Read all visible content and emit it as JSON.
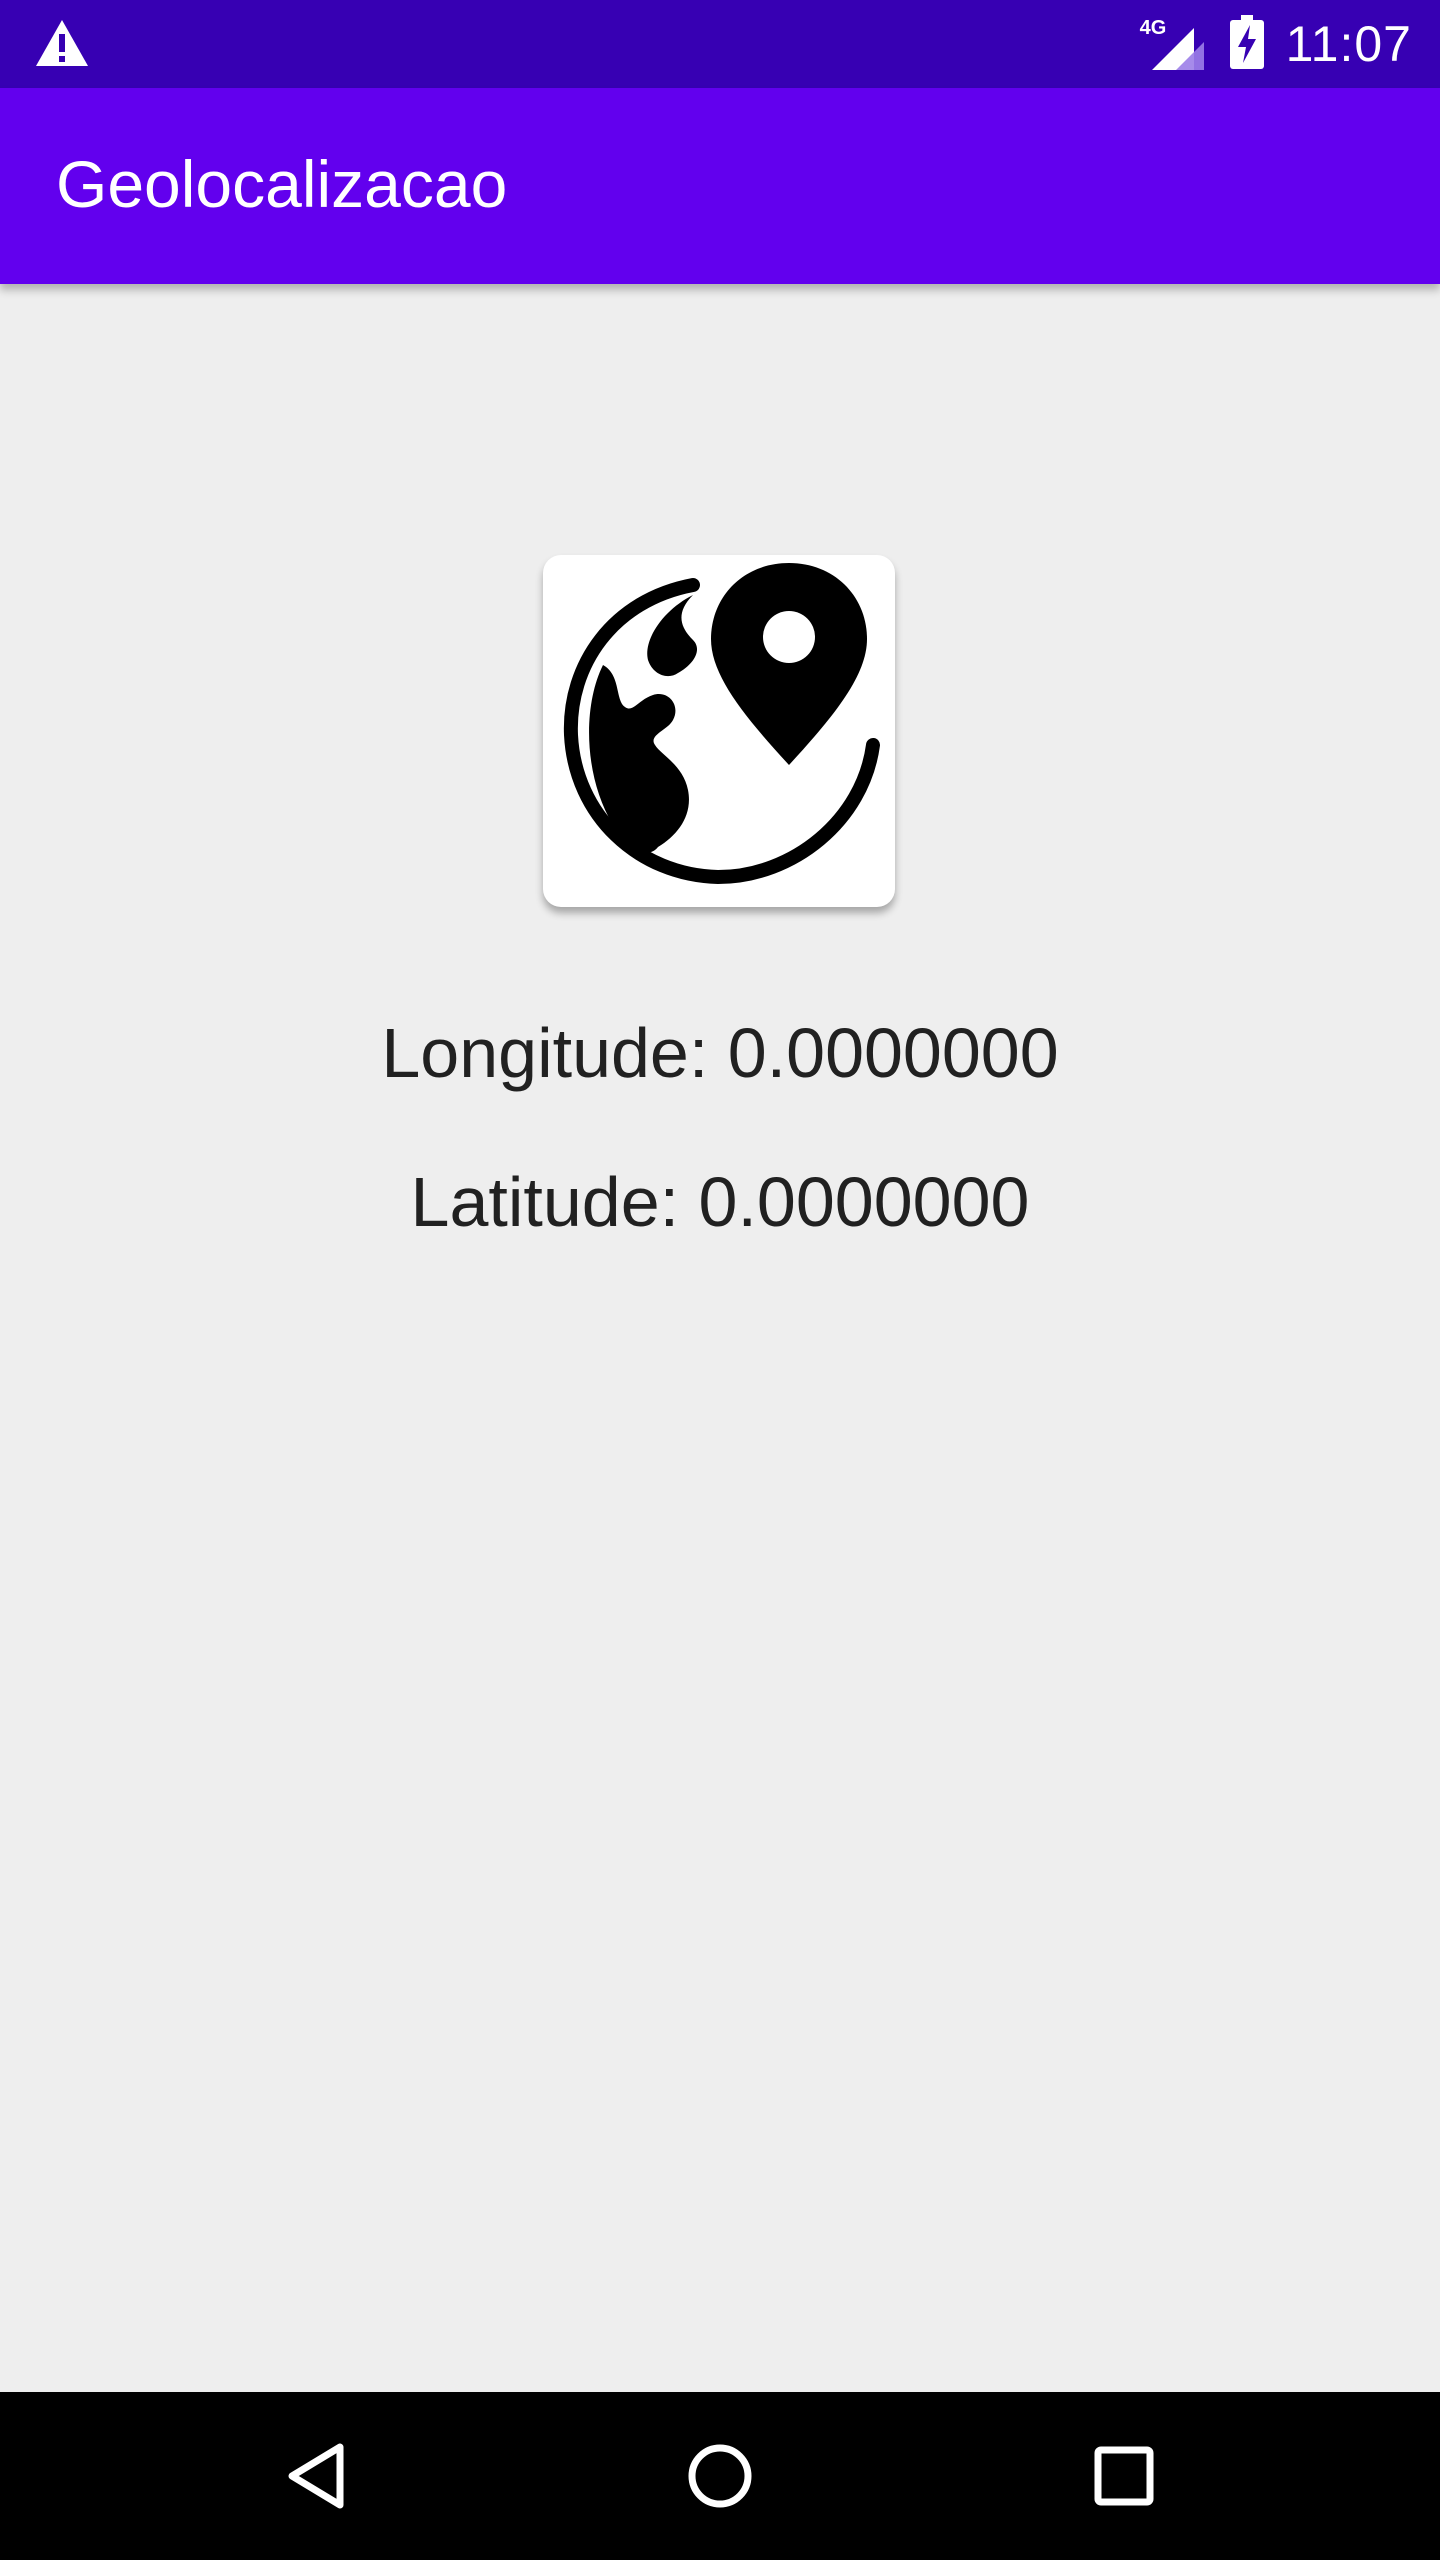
{
  "status_bar": {
    "warning_icon": "warning-icon",
    "network_label": "4G",
    "signal_icon": "signal-icon",
    "battery_icon": "battery-charging-icon",
    "time": "11:07"
  },
  "app_bar": {
    "title": "Geolocalizacao"
  },
  "main": {
    "logo_icon": "globe-location-icon",
    "longitude_text": "Longitude: 0.0000000",
    "latitude_text": "Latitude: 0.0000000"
  },
  "nav_bar": {
    "back_icon": "back-icon",
    "home_icon": "home-icon",
    "recents_icon": "recents-icon"
  },
  "colors": {
    "status_bar": "#3700b3",
    "app_bar": "#6200ee",
    "background": "#eeeeee",
    "text": "#212121",
    "nav_bar": "#000000"
  }
}
